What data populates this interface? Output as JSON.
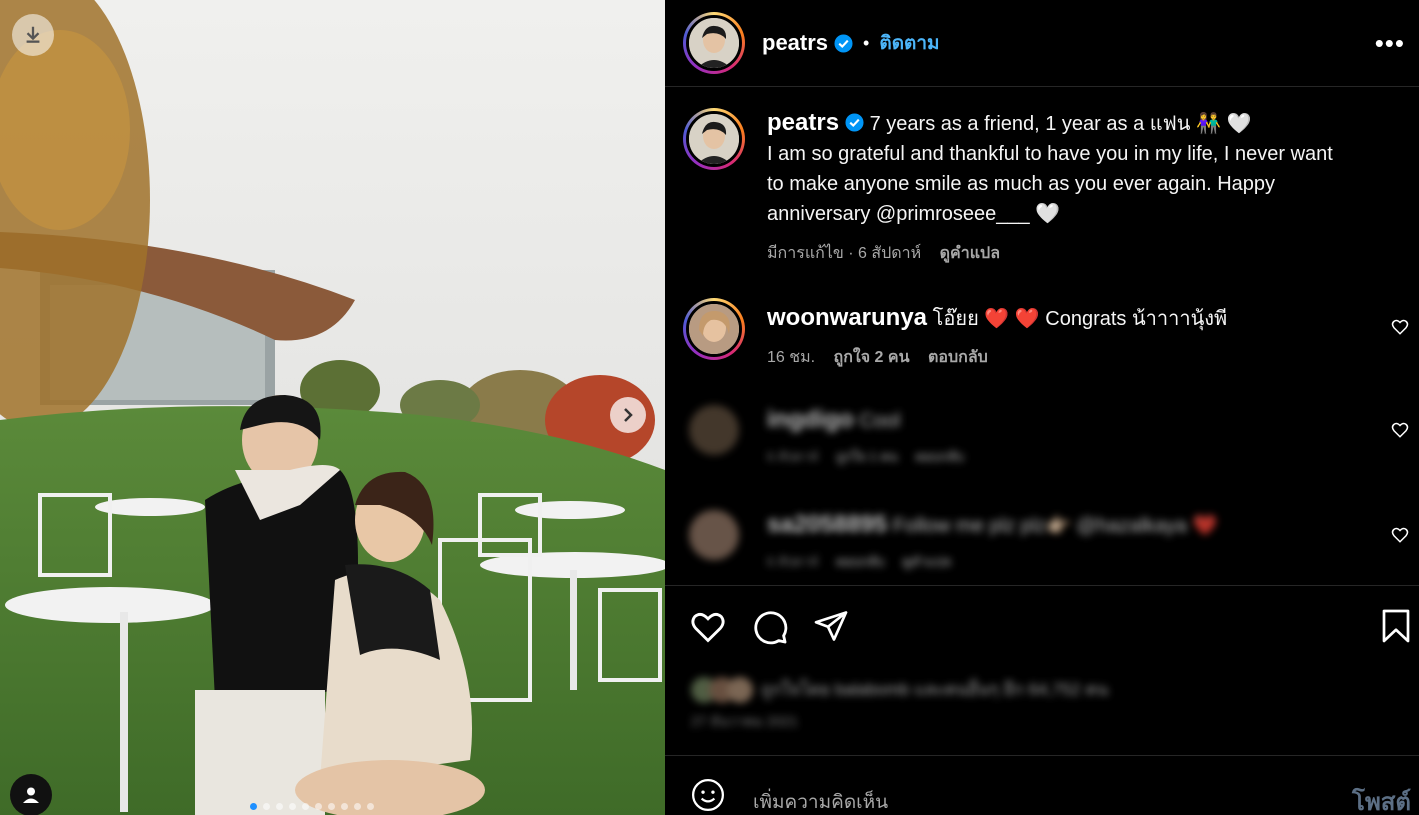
{
  "photo": {
    "carousel_dots": 10,
    "active_dot": 0
  },
  "header": {
    "username": "peatrs",
    "separator": "•",
    "follow_label": "ติดตาม",
    "more_label": "•••"
  },
  "caption": {
    "username": "peatrs",
    "text_line1": "7 years as a friend, 1 year as a แฟน 👫 🤍",
    "text_line2": "I am so grateful and thankful to have you in my life, I never want",
    "text_line3": "to make anyone smile as much as you ever again. Happy",
    "text_line4": "anniversary @primroseee___ 🤍",
    "edited": "มีการแก้ไข",
    "dot": " · ",
    "time": "6 สัปดาห์",
    "translate": "ดูคำแปล"
  },
  "comments": [
    {
      "username": "woonwarunya",
      "text": "โอ๊ยย ❤️ ❤️ Congrats น้าาาานุ้งพี",
      "time": "16 ชม.",
      "likes": "ถูกใจ 2 คน",
      "reply": "ตอบกลับ"
    },
    {
      "username": "ingdigo",
      "text": "Cool",
      "time": "6 สัปดาห์",
      "likes": "ถูกใจ 1 คน",
      "reply": "ตอบกลับ"
    },
    {
      "username": "sa2058895",
      "text": "Follow me plz plz👉🏻 @hazalkaya ❤️",
      "time": "6 สัปดาห์",
      "reply": "ตอบกลับ",
      "translate": "ดูคำแปล"
    }
  ],
  "engagement": {
    "likes_text": "ถูกใจโดย balabomb และคนอื่นๆ อีก 64,752 คน",
    "date": "27 ธันวาคม 2021"
  },
  "composer": {
    "placeholder": "เพิ่มความคิดเห็น",
    "post_label": "โพสต์"
  },
  "colors": {
    "link_blue": "#4cb5f9",
    "verified_blue": "#0095f6",
    "like_red": "#ff3040"
  }
}
